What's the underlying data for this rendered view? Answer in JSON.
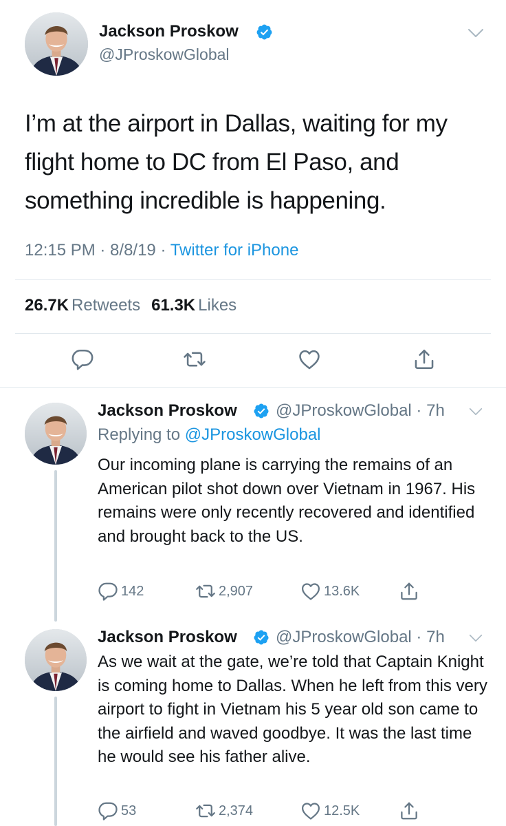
{
  "main_tweet": {
    "author_name": "Jackson Proskow",
    "handle": "@JProskowGlobal",
    "text": "I’m at the airport in Dallas, waiting for my flight home to DC from El Paso, and something incredible is happening.",
    "time": "12:15 PM · 8/8/19 · ",
    "source": "Twitter for iPhone",
    "retweet_count": "26.7K",
    "retweet_label": "Retweets",
    "like_count": "61.3K",
    "like_label": "Likes"
  },
  "replies": [
    {
      "author_name": "Jackson Proskow",
      "handle": "@JProskowGlobal · 7h",
      "replying_prefix": "Replying to ",
      "replying_to": "@JProskowGlobal",
      "text": "Our incoming plane is carrying the remains of an American pilot shot down over Vietnam in 1967. His remains were only recently recovered and identified and brought back to the US.",
      "reply_count": "142",
      "retweet_count": "2,907",
      "like_count": "13.6K"
    },
    {
      "author_name": "Jackson Proskow",
      "handle": "@JProskowGlobal · 7h",
      "text": "As we wait at the gate, we’re told that Captain Knight is coming home to Dallas. When he left from this very airport to fight in Vietnam his 5 year old son came to the airfield and waved goodbye. It was the last time he would see his father alive.",
      "reply_count": "53",
      "retweet_count": "2,374",
      "like_count": "12.5K"
    }
  ],
  "icons": {
    "verified": "verified-badge-icon",
    "chevron": "chevron-down-icon",
    "reply": "reply-icon",
    "retweet": "retweet-icon",
    "like": "heart-icon",
    "share": "share-icon"
  },
  "colors": {
    "accent": "#1da1f2",
    "link": "#1b95e0",
    "muted": "#657786",
    "text": "#14171a",
    "divider": "#e1e8ed"
  }
}
